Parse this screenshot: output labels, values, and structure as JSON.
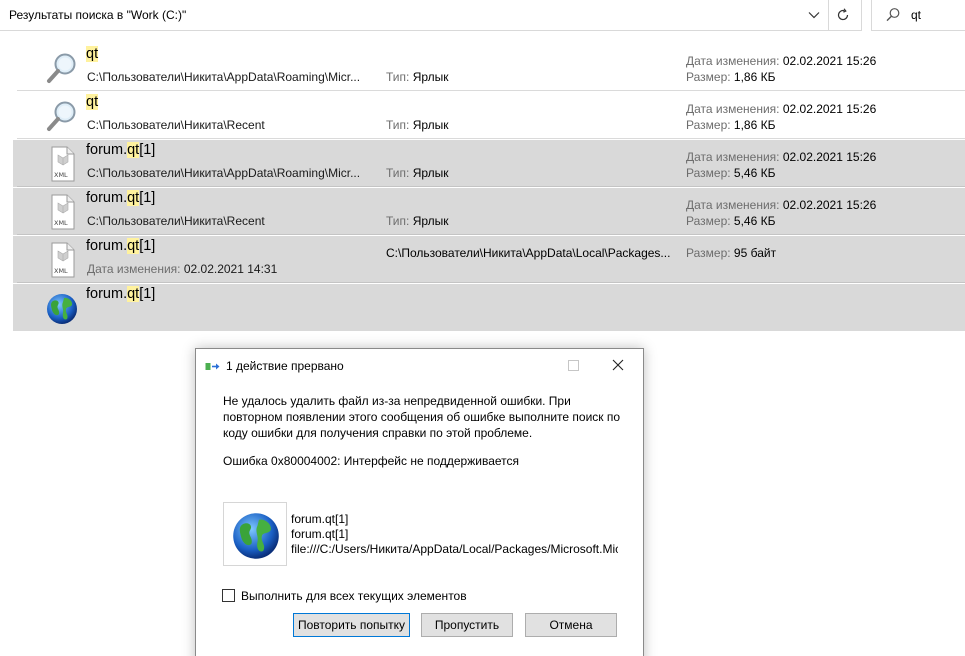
{
  "address_bar": {
    "text": "Результаты поиска в \"Work (C:)\""
  },
  "search": {
    "query": "qt"
  },
  "results": [
    {
      "icon": "search-shortcut-icon",
      "name_pre": "",
      "name_hl": "qt",
      "name_post": "",
      "path": "C:\\Пользователи\\Никита\\AppData\\Roaming\\Micr...",
      "type_label": "Тип:",
      "type_value": "Ярлык",
      "date_label": "Дата изменения:",
      "date_value": "02.02.2021 15:26",
      "size_label": "Размер:",
      "size_value": "1,86 КБ",
      "selected": false
    },
    {
      "icon": "search-shortcut-icon",
      "name_pre": "",
      "name_hl": "qt",
      "name_post": "",
      "path": "C:\\Пользователи\\Никита\\Recent",
      "type_label": "Тип:",
      "type_value": "Ярлык",
      "date_label": "Дата изменения:",
      "date_value": "02.02.2021 15:26",
      "size_label": "Размер:",
      "size_value": "1,86 КБ",
      "selected": false
    },
    {
      "icon": "xml-file-icon",
      "name_pre": "forum.",
      "name_hl": "qt",
      "name_post": "[1]",
      "path": "C:\\Пользователи\\Никита\\AppData\\Roaming\\Micr...",
      "type_label": "Тип:",
      "type_value": "Ярлык",
      "date_label": "Дата изменения:",
      "date_value": "02.02.2021 15:26",
      "size_label": "Размер:",
      "size_value": "5,46 КБ",
      "selected": true
    },
    {
      "icon": "xml-file-icon",
      "name_pre": "forum.",
      "name_hl": "qt",
      "name_post": "[1]",
      "path": "C:\\Пользователи\\Никита\\Recent",
      "type_label": "Тип:",
      "type_value": "Ярлык",
      "date_label": "Дата изменения:",
      "date_value": "02.02.2021 15:26",
      "size_label": "Размер:",
      "size_value": "5,46 КБ",
      "selected": true
    },
    {
      "icon": "xml-file-icon",
      "name_pre": "forum.",
      "name_hl": "qt",
      "name_post": "[1]",
      "sub_label": "Дата изменения:",
      "sub_value": "02.02.2021 14:31",
      "location": "C:\\Пользователи\\Никита\\AppData\\Local\\Packages...",
      "size_label": "Размер:",
      "size_value": "95 байт",
      "selected": true
    },
    {
      "icon": "globe-icon",
      "name_pre": "forum.",
      "name_hl": "qt",
      "name_post": "[1]",
      "selected": true
    }
  ],
  "dialog": {
    "title": "1 действие прервано",
    "message": "Не удалось удалить файл из-за непредвиденной ошибки. При повторном появлении этого сообщения об ошибке выполните поиск по коду ошибки для получения справки по этой проблеме.",
    "error": "Ошибка 0x80004002: Интерфейс не поддерживается",
    "file_name": "forum.qt[1]",
    "file_type": "forum.qt[1]",
    "file_url": "file:///C:/Users/Никита/AppData/Local/Packages/Microsoft.MicrosoftEdge",
    "checkbox_label": "Выполнить для всех текущих элементов",
    "checkbox_checked": false,
    "buttons": {
      "retry": "Повторить попытку",
      "skip": "Пропустить",
      "cancel": "Отмена"
    }
  }
}
